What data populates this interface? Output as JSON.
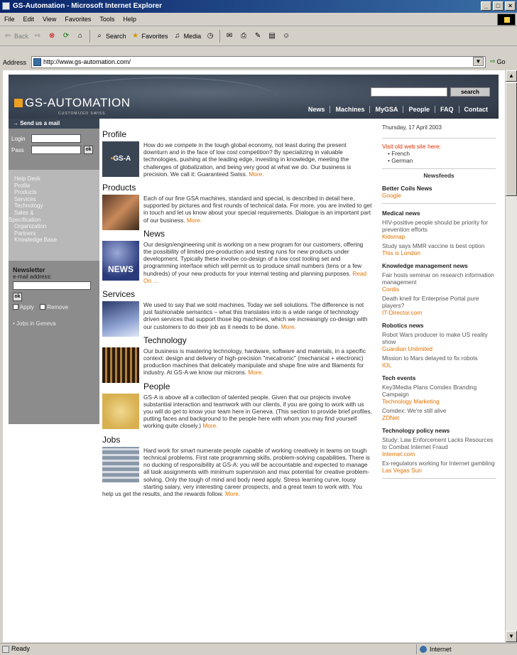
{
  "window": {
    "title": "GS-Automation - Microsoft Internet Explorer",
    "btn_min": "_",
    "btn_max": "□",
    "btn_close": "×"
  },
  "menu": [
    "File",
    "Edit",
    "View",
    "Favorites",
    "Tools",
    "Help"
  ],
  "toolbar": {
    "back": "Back",
    "search": "Search",
    "favorites": "Favorites",
    "media": "Media"
  },
  "address": {
    "label": "Address",
    "url": "http://www.gs-automation.com/",
    "go": "Go"
  },
  "status": {
    "text": "Ready",
    "zone": "Internet"
  },
  "page": {
    "logo": "GS-AUTOMATION",
    "logo_sub": "CUSTOMIZED SWISS",
    "search_button": "search",
    "nav": [
      "News",
      "Machines",
      "MyGSA",
      "People",
      "FAQ",
      "Contact"
    ],
    "left": {
      "send_mail": "→ Send us a mail",
      "login_label": "Login",
      "pass_label": "Pass",
      "ok": "ok",
      "nav_items": [
        "Help Desk",
        "Profile",
        "Products",
        "Services",
        "Technology",
        "Sales &",
        "Specification",
        "Organization",
        "Partners",
        "Knowledge Base"
      ],
      "newsletter_title": "Newsletter",
      "email_label": "e-mail address:",
      "apply_label": "Apply",
      "remove_label": "Remove",
      "jobs": "Jobs in Geneva"
    },
    "sections": [
      {
        "title": "Profile",
        "text": "How do we compete in the tough global economy, not least during the present downturn and in the face of low cost competition? By specializing in valuable technologies, pushing at the leading edge, investing in knowledge, meeting the challenges of globalization, and being very good at what we do. Our business is precision. We call it: Guaranteed Swiss.",
        "more": "More."
      },
      {
        "title": "Products",
        "text": "Each of our fine GSA machines, standard and special, is described in detail here, supported by pictures and first rounds of technical data. For more, you are invited to get in touch and let us know about your special requirements. Dialogue is an important part of our business.",
        "more": "More."
      },
      {
        "title": "News",
        "text": "Our design/engineering unit is working on a new program for our customers, offering the possibility of limited pre-production and testing runs for new products under development. Typically these involve co-design of a low cost tooling set and programming interface which will permit us to produce small numbers (tens or a few hundreds) of your new products for your internal testing and planning purposes.",
        "more": "Read On ..."
      },
      {
        "title": "Services",
        "text": "We used to say that we sold machines. Today we sell solutions. The difference is not just fashionable semantics – what this translates into is a wide range of technology driven services that support those big machines, which we increasingly co-design with our customers to do their job as it needs to be done.",
        "more": "More."
      },
      {
        "title": "Technology",
        "text": "Our business is mastering technology, hardware, software and materials, in a specific context: design and delivery of high-precision \"mecatronic\" (mechanical + electronic) production machines that delicately manipulate and shape fine wire and filaments for industry. At GS-A we know our microns.",
        "more": "More."
      },
      {
        "title": "People",
        "text": "GS-A is above all a collection of talented people. Given that our projects involve substantial interaction and teamwork with our clients, if you are going to work with us you will do get to know your team here in Geneva. (This section to provide brief profiles, putting faces and background to the people here with whom you may find yourself working quite closely.)",
        "more": "More."
      },
      {
        "title": "Jobs",
        "text": "Hard work for smart numerate people capable of working creatively in teams on tough technical problems. First rate programming skills, problem-solving capabilities. There is no ducking of responsibility at GS-A: you will be accountable and expected to manage all task assignments with minimum supervision and max potential for creative problem-solving. Only the tough of mind and body need apply. Stress learning curve, lousy starting salary, very interesting career prospects, and a great team to work with. You help us get the results, and the rewards follow.",
        "more": "More."
      }
    ],
    "right": {
      "date": "Thursday, 17 April 2003",
      "visit": "Visit old web site here:",
      "langs": [
        "French",
        "German"
      ],
      "newsfeeds": "Newsfeeds",
      "feeds": [
        {
          "cat": "Better Coils News",
          "items": [
            {
              "t": "",
              "s": "Google"
            }
          ]
        },
        {
          "cat": "Medical news",
          "items": [
            {
              "t": "HIV-positive people should be priority for prevention efforts",
              "s": "Kidsmap"
            },
            {
              "t": "Study says MMR vaccine is best option",
              "s": "This is London"
            }
          ]
        },
        {
          "cat": "Knowledge management news",
          "items": [
            {
              "t": "Fair hosts seminar on research information management",
              "s": "Cordis"
            },
            {
              "t": "Death knell for Enterprise Portal pure players?",
              "s": "IT-Director.com"
            }
          ]
        },
        {
          "cat": "Robotics news",
          "items": [
            {
              "t": "Robot Wars producer to make US reality show",
              "s": "Guardian Unlimited"
            },
            {
              "t": "Mission to Mars delayed to fix robots",
              "s": "IOL"
            }
          ]
        },
        {
          "cat": "Tech events",
          "items": [
            {
              "t": "Key3Media Plans Comdex Branding Campaign",
              "s": "Technology Marketing"
            },
            {
              "t": "Comdex: We're still alive",
              "s": "ZDNet"
            }
          ]
        },
        {
          "cat": "Technology policy news",
          "items": [
            {
              "t": "Study: Law Enforcement Lacks Resources to Combat Internet Fraud",
              "s": "Internet.com"
            },
            {
              "t": "Ex-regulators working for Internet gambling",
              "s": "Las Vegas Sun"
            }
          ]
        }
      ]
    }
  }
}
